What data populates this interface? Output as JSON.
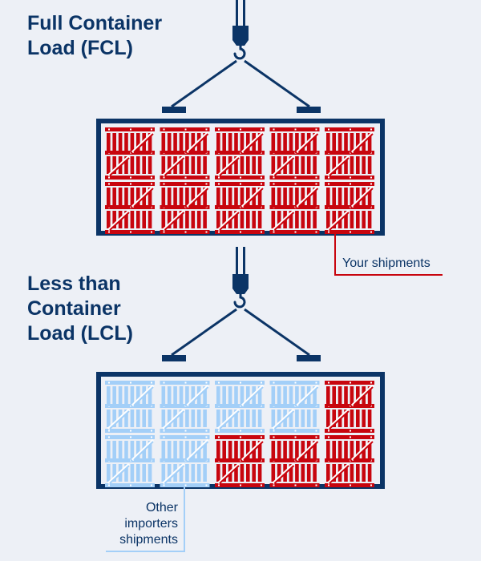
{
  "fcl": {
    "title_line1": "Full Container",
    "title_line2": "Load (FCL)",
    "crates": [
      "yours",
      "yours",
      "yours",
      "yours",
      "yours",
      "yours",
      "yours",
      "yours",
      "yours",
      "yours"
    ],
    "callout": "Your shipments"
  },
  "lcl": {
    "title_line1": "Less than",
    "title_line2": "Container",
    "title_line3": "Load (LCL)",
    "crates": [
      "other",
      "other",
      "other",
      "other",
      "yours",
      "other",
      "other",
      "yours",
      "yours",
      "yours"
    ],
    "callout_line1": "Other",
    "callout_line2": "importers",
    "callout_line3": "shipments"
  },
  "colors": {
    "navy": "#0b3466",
    "yours": "#c8050e",
    "other": "#a3cff8",
    "background": "#edf0f6"
  }
}
